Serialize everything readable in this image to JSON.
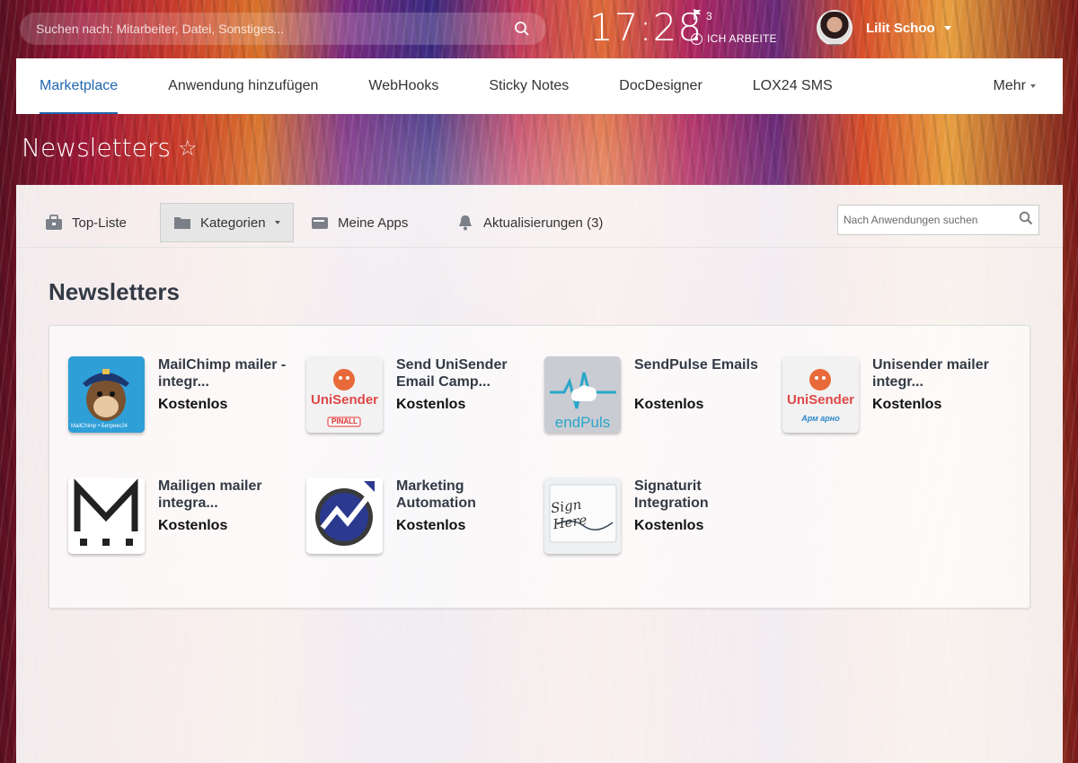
{
  "search": {
    "placeholder": "Suchen nach: Mitarbeiter, Datei, Sonstiges..."
  },
  "clock": "17:28",
  "flag_count": "3",
  "work_status": "ICH ARBEITE",
  "user": {
    "name": "Lilit Schoo"
  },
  "nav": {
    "items": [
      "Marketplace",
      "Anwendung hinzufügen",
      "WebHooks",
      "Sticky Notes",
      "DocDesigner",
      "LOX24 SMS"
    ],
    "more": "Mehr"
  },
  "page_title": "Newsletters",
  "toolbar": {
    "top": "Top-Liste",
    "categories": "Kategorien",
    "my_apps": "Meine Apps",
    "updates": "Aktualisierungen (3)",
    "search_placeholder": "Nach Anwendungen suchen"
  },
  "section_title": "Newsletters",
  "apps": [
    {
      "name": "MailChimp mailer - integr...",
      "price": "Kostenlos",
      "logo_text": "MailChimp • Битрикс24"
    },
    {
      "name": "Send UniSender Email Camp...",
      "price": "Kostenlos",
      "logo_text": "UniSender",
      "logo_sub": "PINALL"
    },
    {
      "name": "SendPulse Emails",
      "price": "Kostenlos",
      "logo_text": "endPuls"
    },
    {
      "name": "Unisender mailer integr...",
      "price": "Kostenlos",
      "logo_text": "UniSender",
      "logo_sub": "Арм арно"
    },
    {
      "name": "Mailigen mailer integra...",
      "price": "Kostenlos",
      "logo_text": "M"
    },
    {
      "name": "Marketing Automation",
      "price": "Kostenlos"
    },
    {
      "name": "Signaturit Integration",
      "price": "Kostenlos",
      "logo_text": "Sign Here"
    }
  ],
  "colors": {
    "accent": "#2067b0",
    "text_dark": "#333a45"
  }
}
